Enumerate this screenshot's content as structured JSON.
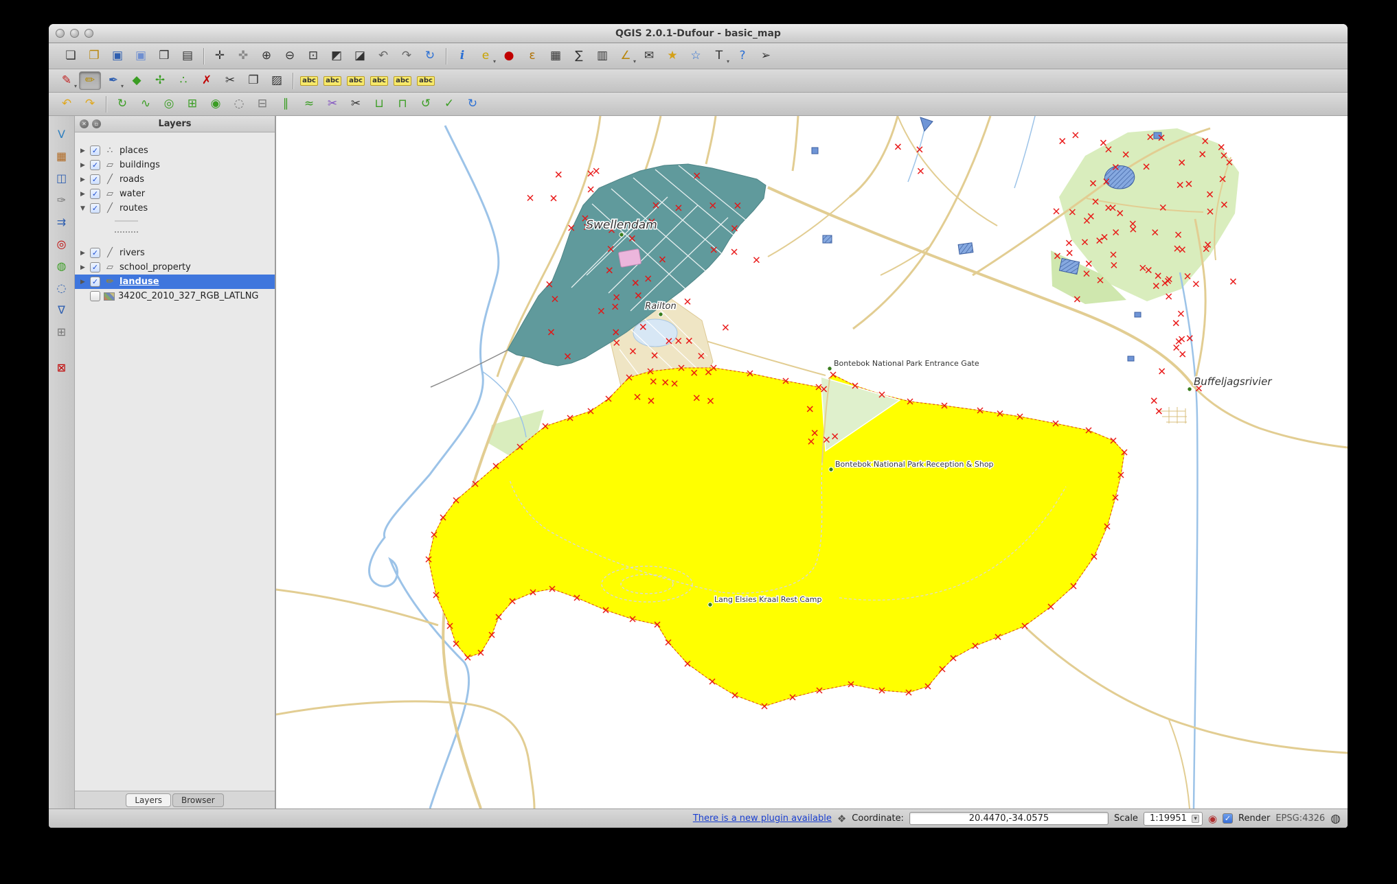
{
  "window": {
    "title": "QGIS 2.0.1-Dufour - basic_map"
  },
  "colors": {
    "selection_blue": "#3f76dd",
    "landuse_yellow": "#ffff00",
    "urban_teal": "#609a9c",
    "park_green": "#d9edbd",
    "road_tan": "#e2cd92",
    "marker_red": "#e81010",
    "water_blue": "#9cc3e8"
  },
  "toolbars": {
    "row1": [
      {
        "name": "new-project",
        "glyph": "❏",
        "fg": "#333"
      },
      {
        "name": "open-project",
        "glyph": "❐",
        "fg": "#b8860b"
      },
      {
        "name": "save-project",
        "glyph": "▣",
        "fg": "#2f5fb0"
      },
      {
        "name": "save-project-as",
        "glyph": "▣",
        "fg": "#6f8fd0"
      },
      {
        "name": "new-print-composer",
        "glyph": "❒",
        "fg": "#333"
      },
      {
        "name": "composer-manager",
        "glyph": "▤",
        "fg": "#333"
      },
      {
        "sep": true
      },
      {
        "name": "pan-map",
        "glyph": "✛",
        "fg": "#333"
      },
      {
        "name": "pan-to-selection",
        "glyph": "✜",
        "fg": "#888"
      },
      {
        "name": "zoom-in",
        "glyph": "⊕",
        "fg": "#333"
      },
      {
        "name": "zoom-out",
        "glyph": "⊖",
        "fg": "#333"
      },
      {
        "name": "zoom-full",
        "glyph": "⊡",
        "fg": "#333"
      },
      {
        "name": "zoom-to-selection",
        "glyph": "◩",
        "fg": "#333"
      },
      {
        "name": "zoom-to-layer",
        "glyph": "◪",
        "fg": "#333"
      },
      {
        "name": "zoom-last",
        "glyph": "↶",
        "fg": "#666"
      },
      {
        "name": "zoom-next",
        "glyph": "↷",
        "fg": "#666"
      },
      {
        "name": "map-refresh",
        "glyph": "↻",
        "fg": "#2a6fd4"
      },
      {
        "sep": true
      },
      {
        "name": "identify-features",
        "glyph": "i",
        "fg": "#2a6fd4",
        "italic": true
      },
      {
        "name": "run-feature-action",
        "glyph": "e",
        "fg": "#c9a400",
        "menu": true
      },
      {
        "name": "deselect-all",
        "glyph": "●",
        "fg": "#c00000"
      },
      {
        "name": "select-by-expression",
        "glyph": "ε",
        "fg": "#b07000"
      },
      {
        "name": "open-attribute-table",
        "glyph": "▦",
        "fg": "#333"
      },
      {
        "name": "field-calculator",
        "glyph": "∑",
        "fg": "#333"
      },
      {
        "name": "statistics-summary",
        "glyph": "▥",
        "fg": "#333"
      },
      {
        "name": "measure",
        "glyph": "∠",
        "fg": "#b8860b",
        "menu": true
      },
      {
        "name": "map-tips",
        "glyph": "✉",
        "fg": "#333"
      },
      {
        "name": "new-bookmark",
        "glyph": "★",
        "fg": "#d4a017"
      },
      {
        "name": "show-bookmarks",
        "glyph": "☆",
        "fg": "#2a6fd4"
      },
      {
        "name": "text-annotation",
        "glyph": "T",
        "fg": "#333",
        "menu": true
      },
      {
        "name": "help-contents",
        "glyph": "?",
        "fg": "#2a6fd4"
      },
      {
        "name": "whats-this",
        "glyph": "➢",
        "fg": "#333"
      }
    ],
    "row2": [
      {
        "name": "current-edits",
        "glyph": "✎",
        "fg": "#c02020",
        "menu": true
      },
      {
        "name": "toggle-editing",
        "glyph": "✏",
        "fg": "#b58a00",
        "pressed": true
      },
      {
        "name": "save-layer-edits",
        "glyph": "✒",
        "fg": "#2f5fb0",
        "menu": true
      },
      {
        "name": "add-feature",
        "glyph": "◆",
        "fg": "#3a9d23"
      },
      {
        "name": "move-feature",
        "glyph": "✢",
        "fg": "#3a9d23"
      },
      {
        "name": "node-tool",
        "glyph": "∴",
        "fg": "#3a9d23"
      },
      {
        "name": "delete-selected",
        "glyph": "✗",
        "fg": "#c00000"
      },
      {
        "name": "cut-features",
        "glyph": "✂",
        "fg": "#333"
      },
      {
        "name": "copy-features",
        "glyph": "❐",
        "fg": "#333"
      },
      {
        "name": "paste-features",
        "glyph": "▨",
        "fg": "#333"
      },
      {
        "sep": true
      },
      {
        "name": "labeling-options",
        "glyph": "abc",
        "badge": true
      },
      {
        "name": "label-pin",
        "glyph": "abc",
        "badge": true
      },
      {
        "name": "label-show-hide",
        "glyph": "abc",
        "badge": true
      },
      {
        "name": "label-move",
        "glyph": "abc",
        "badge": true
      },
      {
        "name": "label-rotate",
        "glyph": "abc",
        "badge": true
      },
      {
        "name": "label-properties",
        "glyph": "abc",
        "badge": true
      }
    ],
    "row3": [
      {
        "name": "undo",
        "glyph": "↶",
        "fg": "#e0a81f"
      },
      {
        "name": "redo",
        "glyph": "↷",
        "fg": "#e0a81f"
      },
      {
        "sep": true
      },
      {
        "name": "rotate-feature",
        "glyph": "↻",
        "fg": "#3a9d23"
      },
      {
        "name": "simplify-feature",
        "glyph": "∿",
        "fg": "#3a9d23"
      },
      {
        "name": "add-ring",
        "glyph": "◎",
        "fg": "#3a9d23"
      },
      {
        "name": "add-part",
        "glyph": "⊞",
        "fg": "#3a9d23"
      },
      {
        "name": "fill-ring",
        "glyph": "◉",
        "fg": "#3a9d23"
      },
      {
        "name": "delete-ring",
        "glyph": "◌",
        "fg": "#777"
      },
      {
        "name": "delete-part",
        "glyph": "⊟",
        "fg": "#777"
      },
      {
        "name": "offset-curve",
        "glyph": "∥",
        "fg": "#3a9d23"
      },
      {
        "name": "reshape-features",
        "glyph": "≈",
        "fg": "#3a9d23"
      },
      {
        "name": "split-parts",
        "glyph": "✂",
        "fg": "#8050c0"
      },
      {
        "name": "split-features",
        "glyph": "✂",
        "fg": "#333"
      },
      {
        "name": "merge-features",
        "glyph": "⊔",
        "fg": "#3a9d23"
      },
      {
        "name": "merge-attributes",
        "glyph": "⊓",
        "fg": "#3a9d23"
      },
      {
        "name": "rotate-point-symbols",
        "glyph": "↺",
        "fg": "#3a9d23"
      },
      {
        "name": "check-geometries",
        "glyph": "✓",
        "fg": "#3a9d23"
      },
      {
        "name": "sync-edits",
        "glyph": "↻",
        "fg": "#2a6fd4"
      }
    ],
    "left_strip": [
      {
        "name": "add-vector-layer",
        "glyph": "V",
        "fg": "#2f7fbf"
      },
      {
        "name": "add-raster-layer",
        "glyph": "▦",
        "fg": "#b06820"
      },
      {
        "name": "add-postgis-layer",
        "glyph": "◫",
        "fg": "#2f5fb0"
      },
      {
        "name": "add-spatialite-layer",
        "glyph": "✑",
        "fg": "#777"
      },
      {
        "name": "add-mssql-layer",
        "glyph": "⇉",
        "fg": "#2f5fb0"
      },
      {
        "name": "add-oracle-layer",
        "glyph": "◎",
        "fg": "#c00000"
      },
      {
        "name": "add-wms-layer",
        "glyph": "◍",
        "fg": "#3a9d23"
      },
      {
        "name": "add-wcs-layer",
        "glyph": "◌",
        "fg": "#2f5fb0"
      },
      {
        "name": "add-wfs-layer",
        "glyph": "∇",
        "fg": "#2f5fb0"
      },
      {
        "name": "new-shapefile-layer",
        "glyph": "⊞",
        "fg": "#777"
      },
      {
        "gap": true
      },
      {
        "name": "remove-layer",
        "glyph": "⊠",
        "fg": "#c00000"
      }
    ]
  },
  "layers_panel": {
    "title": "Layers",
    "tabs": [
      "Layers",
      "Browser"
    ],
    "items": [
      {
        "label": "places",
        "checked": true,
        "icon": "point"
      },
      {
        "label": "buildings",
        "checked": true,
        "icon": "polygon"
      },
      {
        "label": "roads",
        "checked": true,
        "icon": "line"
      },
      {
        "label": "water",
        "checked": true,
        "icon": "polygon"
      },
      {
        "label": "routes",
        "checked": true,
        "icon": "line",
        "expanded": true,
        "children": [
          {
            "swatch": "solid"
          },
          {
            "swatch": "dotted"
          }
        ]
      },
      {
        "label": "rivers",
        "checked": true,
        "icon": "line"
      },
      {
        "label": "school_property",
        "checked": true,
        "icon": "polygon"
      },
      {
        "label": "landuse",
        "checked": true,
        "icon": "pencil",
        "selected": true
      },
      {
        "label": "3420C_2010_327_RGB_LATLNG",
        "checked": false,
        "icon": "raster"
      }
    ]
  },
  "map": {
    "labels": [
      {
        "text": "Swellendam"
      },
      {
        "text": "Railton"
      },
      {
        "text": "Bontebok National Park Entrance Gate"
      },
      {
        "text": "Bontebok National Park Reception & Shop"
      },
      {
        "text": "Lang Elsies Kraal Rest Camp"
      },
      {
        "text": "Buffeljagsrivier"
      }
    ]
  },
  "status_bar": {
    "plugin_link": "There is a new plugin available",
    "coordinate_label": "Coordinate:",
    "coordinate_value": "20.4470,-34.0575",
    "scale_label": "Scale",
    "scale_value": "1:19951",
    "render_label": "Render",
    "render_checked": true,
    "crs": "EPSG:4326"
  }
}
